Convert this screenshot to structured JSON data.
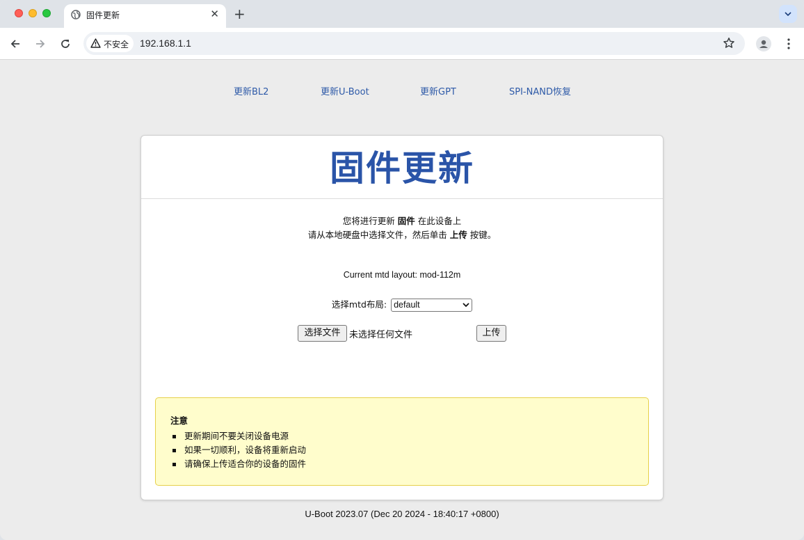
{
  "browser": {
    "tab_title": "固件更新",
    "security_label": "不安全",
    "url": "192.168.1.1"
  },
  "nav": {
    "items": [
      {
        "label": "更新BL2"
      },
      {
        "label": "更新U-Boot"
      },
      {
        "label": "更新GPT"
      },
      {
        "label": "SPI-NAND恢复"
      }
    ]
  },
  "main": {
    "title": "固件更新",
    "intro_line1_pre": "您将进行更新 ",
    "intro_line1_bold": "固件",
    "intro_line1_post": " 在此设备上",
    "intro_line2_pre": "请从本地硬盘中选择文件，然后单击 ",
    "intro_line2_bold": "上传",
    "intro_line2_post": " 按键。",
    "current_layout": "Current mtd layout: mod-112m",
    "select_label": "选择mtd布局:",
    "select_value": "default",
    "choose_file_label": "选择文件",
    "no_file_text": "未选择任何文件",
    "upload_label": "上传"
  },
  "notice": {
    "heading": "注意",
    "items": [
      "更新期间不要关闭设备电源",
      "如果一切顺利，设备将重新启动",
      "请确保上传适合你的设备的固件"
    ]
  },
  "footer": {
    "text": "U-Boot 2023.07 (Dec 20 2024 - 18:40:17 +0800)"
  },
  "colors": {
    "accent": "#2a54a8",
    "link": "#2e5aa8",
    "notice_bg": "#fffdcc",
    "notice_border": "#e6d04a"
  }
}
